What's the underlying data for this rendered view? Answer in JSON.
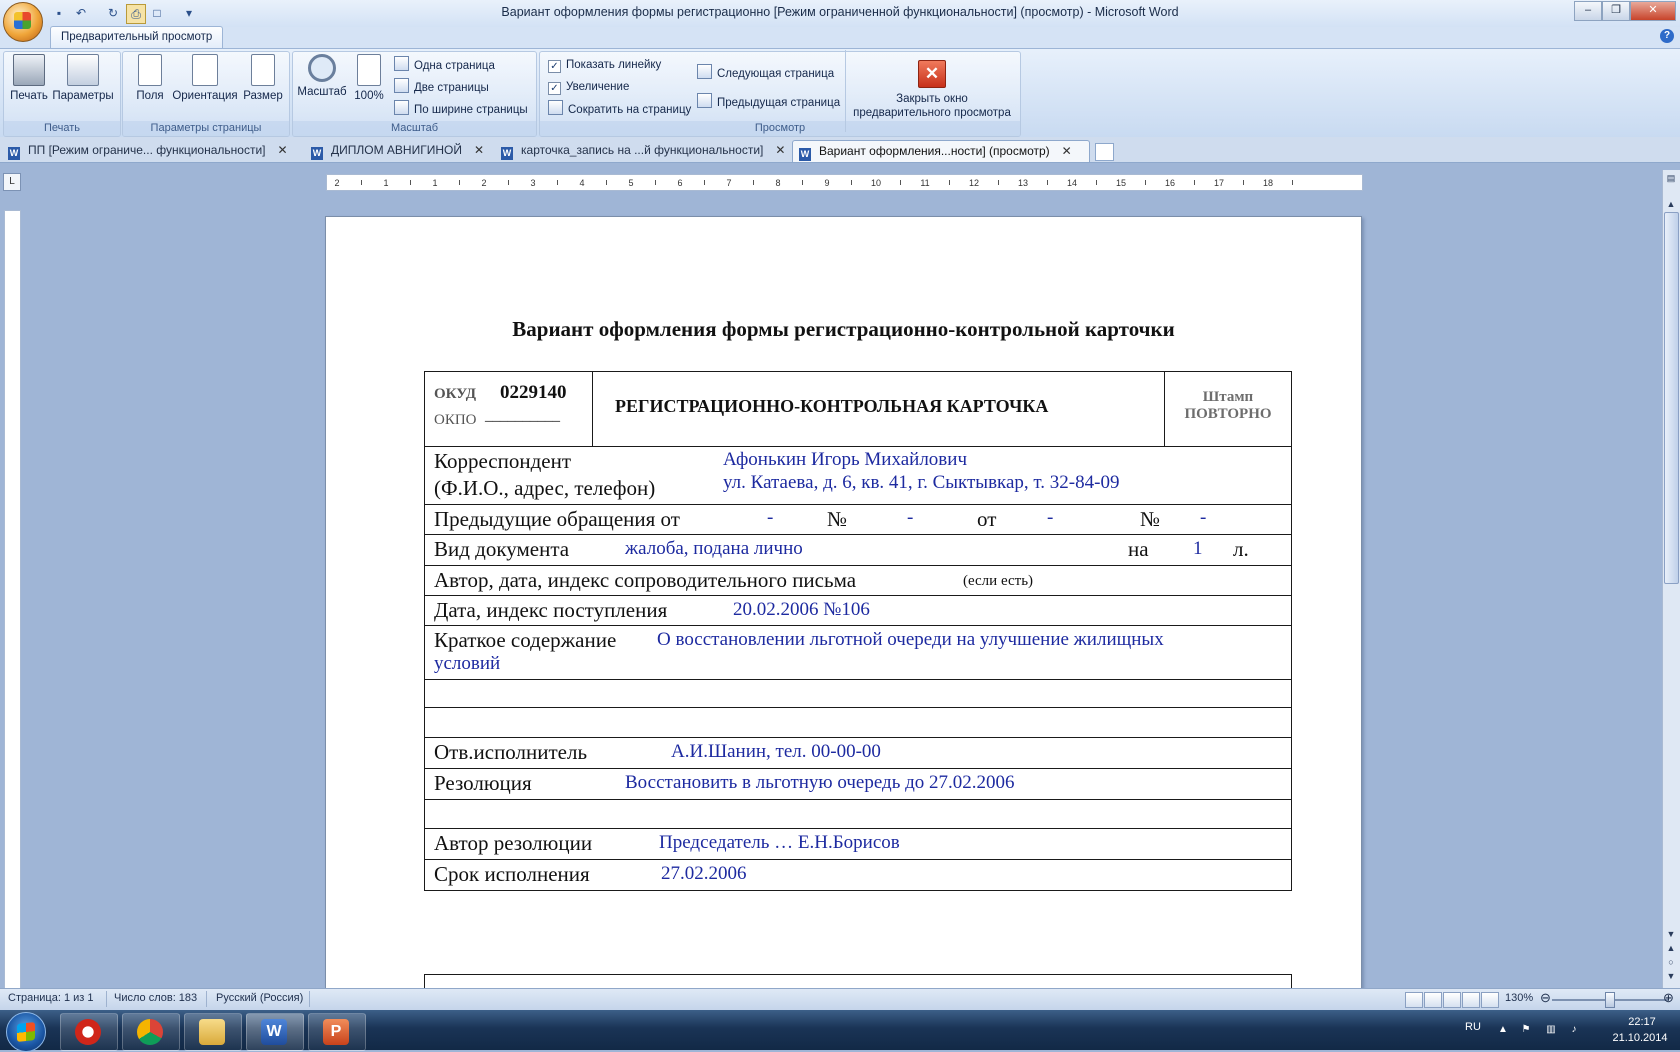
{
  "window": {
    "title": "Вариант оформления формы регистрационно [Режим ограниченной функциональности] (просмотр) - Microsoft Word"
  },
  "ribbon": {
    "active_tab": "Предварительный просмотр",
    "groups": {
      "print": {
        "label": "Печать",
        "print_btn": "Печать",
        "params_btn": "Параметры"
      },
      "page_setup": {
        "label": "Параметры страницы",
        "margins": "Поля",
        "orientation": "Ориентация",
        "size": "Размер"
      },
      "zoom": {
        "label": "Масштаб",
        "zoom_btn": "Масштаб",
        "hundred": "100%",
        "one_page": "Одна страница",
        "two_pages": "Две страницы",
        "page_width": "По ширине страницы"
      },
      "preview": {
        "label": "Просмотр",
        "show_ruler": "Показать линейку",
        "magnifier": "Увеличение",
        "shrink": "Сократить на страницу",
        "next_page": "Следующая страница",
        "prev_page": "Предыдущая страница",
        "close_line1": "Закрыть окно",
        "close_line2": "предварительного просмотра"
      }
    }
  },
  "doc_tabs": [
    {
      "label": "ПП [Режим ограниче... функциональности]"
    },
    {
      "label": "ДИПЛОМ АВНИГИНОЙ"
    },
    {
      "label": "карточка_запись на ...й функциональности]"
    },
    {
      "label": "Вариант оформления...ности] (просмотр)"
    }
  ],
  "ruler": {
    "h_numbers": [
      "2",
      "1",
      "1",
      "2",
      "3",
      "4",
      "5",
      "6",
      "7",
      "8",
      "9",
      "10",
      "11",
      "12",
      "13",
      "14",
      "15",
      "16",
      "17",
      "18"
    ]
  },
  "document": {
    "title": "Вариант оформления формы регистрационно-контрольной карточки",
    "card": {
      "okud_label": "ОКУД",
      "okud_value": "0229140",
      "okpo_label": "ОКПО",
      "okpo_blank": "__________",
      "header": "РЕГИСТРАЦИОННО-КОНТРОЛЬНАЯ КАРТОЧКА",
      "stamp_label": "Штамп",
      "stamp_value": "ПОВТОРНО",
      "correspondent_label1": "Корреспондент",
      "correspondent_label2": "(Ф.И.О., адрес, телефон)",
      "correspondent_name": "Афонькин Игорь Михайлович",
      "correspondent_addr": "ул. Катаева, д. 6, кв. 41, г. Сыктывкар, т. 32-84-09",
      "prev_label": "Предыдущие обращения от",
      "prev_dash1": "-",
      "prev_no1": "№",
      "prev_dash2": "-",
      "prev_from": "от",
      "prev_dash3": "-",
      "prev_no2": "№",
      "prev_dash4": "-",
      "doctype_label": "Вид документа",
      "doctype_value": "жалоба, подана лично",
      "doctype_on": "на",
      "doctype_count": "1",
      "doctype_sheets": "л.",
      "author_label": "Автор, дата, индекс сопроводительного письма",
      "author_note": "(если есть)",
      "received_label": "Дата, индекс поступления",
      "received_value": "20.02.2006  №106",
      "summary_label": "Краткое содержание",
      "summary_value1": "О восстановлении льготной очереди на улучшение жилищных",
      "summary_value2": "условий",
      "executor_label": "Отв.исполнитель",
      "executor_value": "А.И.Шанин, тел. 00-00-00",
      "resolution_label": "Резолюция",
      "resolution_value": "Восстановить в льготную очередь до 27.02.2006",
      "res_author_label": "Автор резолюции",
      "res_author_value": "Председатель … Е.Н.Борисов",
      "deadline_label": "Срок исполнения",
      "deadline_value": "27.02.2006"
    }
  },
  "status": {
    "page": "Страница: 1 из 1",
    "words": "Число слов: 183",
    "lang": "Русский (Россия)",
    "zoom": "130%",
    "zoom_level_percent": 130
  },
  "taskbar": {
    "lang": "RU",
    "time": "22:17",
    "date": "21.10.2014"
  }
}
